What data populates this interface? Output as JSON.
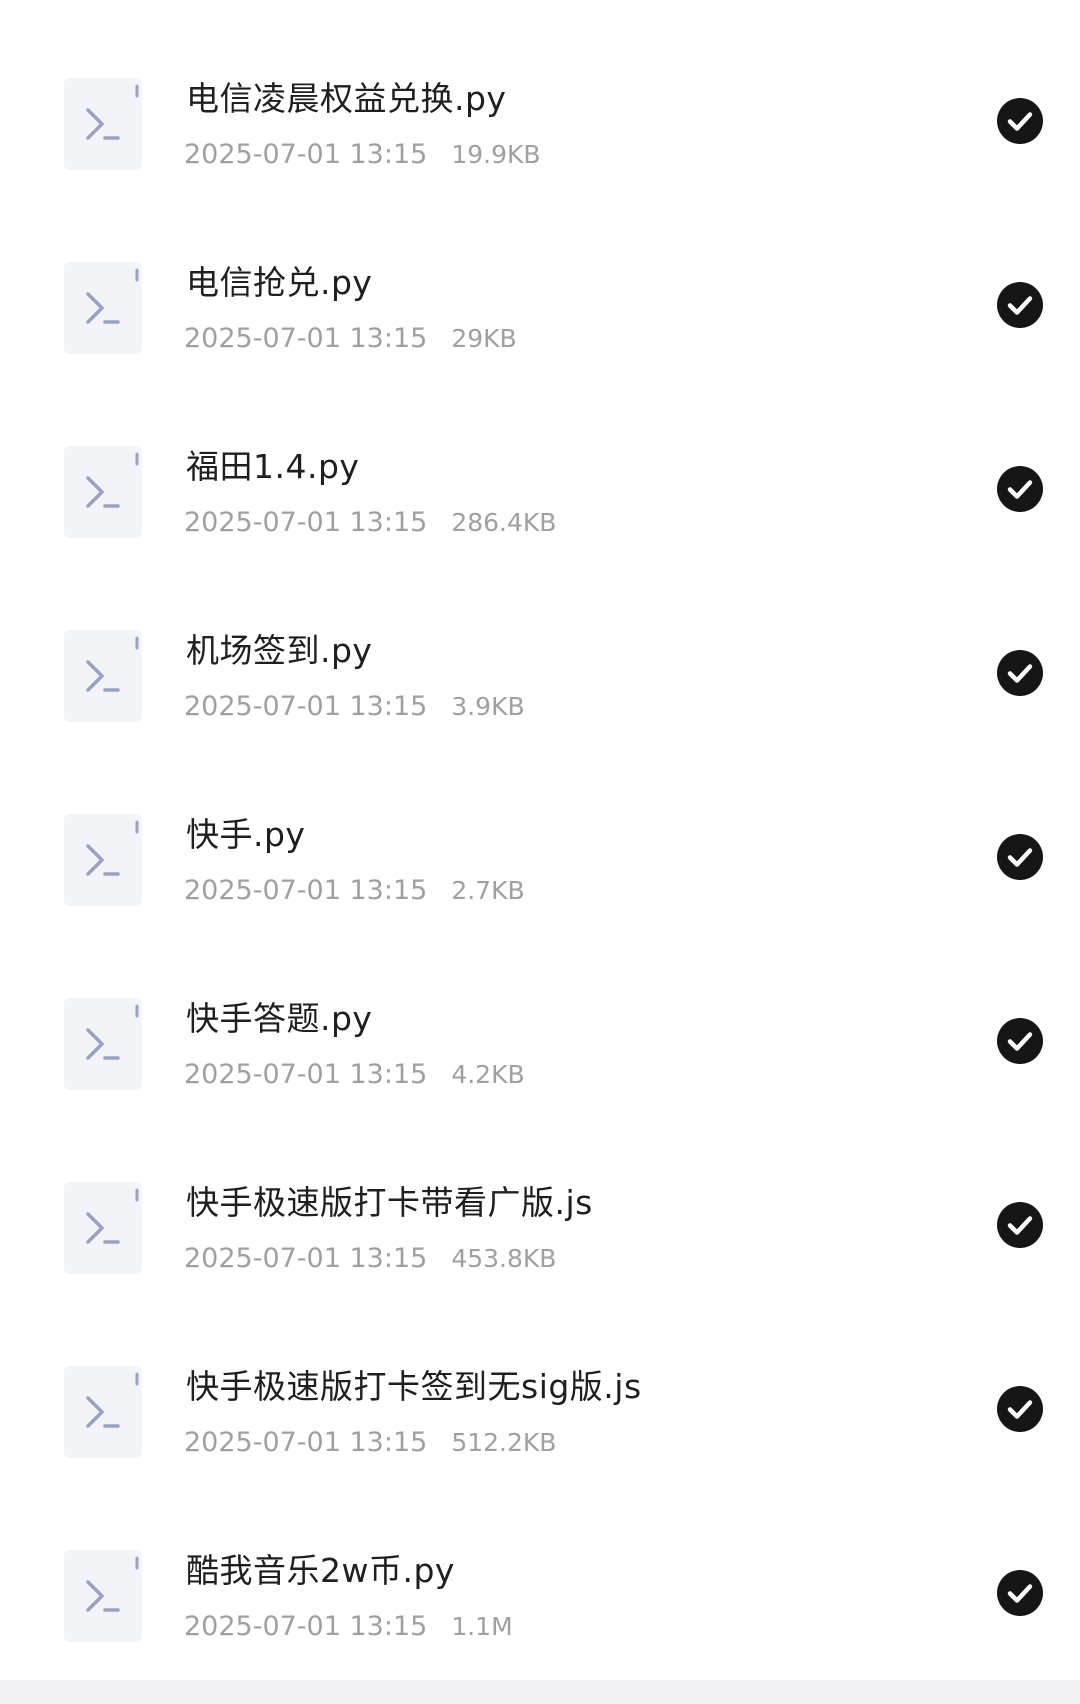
{
  "files": [
    {
      "name": "电信凌晨权益兑换.py",
      "date": "2025-07-01 13:15",
      "size": "19.9KB",
      "selected": true,
      "icon": "terminal-file-icon"
    },
    {
      "name": "电信抢兑.py",
      "date": "2025-07-01 13:15",
      "size": "29KB",
      "selected": true,
      "icon": "terminal-file-icon"
    },
    {
      "name": "福田1.4.py",
      "date": "2025-07-01 13:15",
      "size": "286.4KB",
      "selected": true,
      "icon": "terminal-file-icon"
    },
    {
      "name": "机场签到.py",
      "date": "2025-07-01 13:15",
      "size": "3.9KB",
      "selected": true,
      "icon": "terminal-file-icon"
    },
    {
      "name": "快手.py",
      "date": "2025-07-01 13:15",
      "size": "2.7KB",
      "selected": true,
      "icon": "terminal-file-icon"
    },
    {
      "name": "快手答题.py",
      "date": "2025-07-01 13:15",
      "size": "4.2KB",
      "selected": true,
      "icon": "terminal-file-icon"
    },
    {
      "name": "快手极速版打卡带看广版.js",
      "date": "2025-07-01 13:15",
      "size": "453.8KB",
      "selected": true,
      "icon": "terminal-file-icon"
    },
    {
      "name": "快手极速版打卡签到无sig版.js",
      "date": "2025-07-01 13:15",
      "size": "512.2KB",
      "selected": true,
      "icon": "terminal-file-icon"
    },
    {
      "name": "酷我音乐2w币.py",
      "date": "2025-07-01 13:15",
      "size": "1.1M",
      "selected": true,
      "icon": "terminal-file-icon"
    }
  ],
  "colors": {
    "icon_bg": "#f3f4f8",
    "icon_glyph": "#9aa3c4",
    "check_bg": "#161616",
    "name_text": "#1f1f1f",
    "meta_text": "#a0a0a0"
  }
}
